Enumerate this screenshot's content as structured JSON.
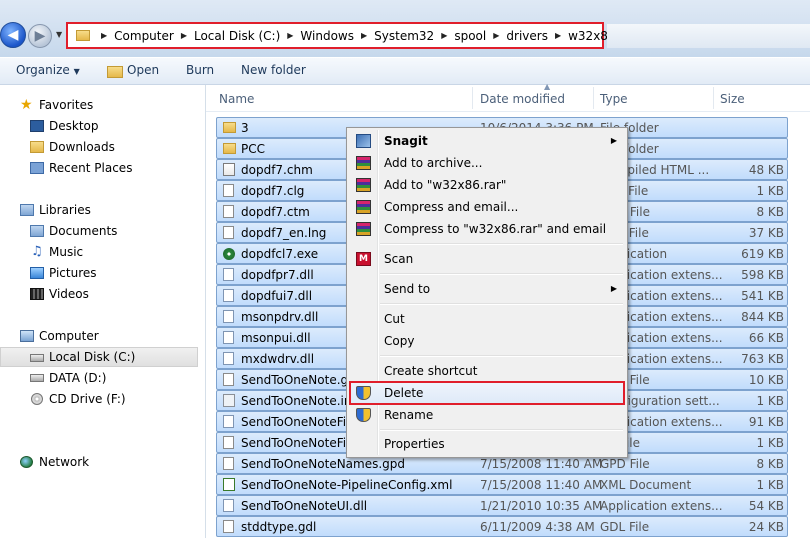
{
  "address": {
    "crumbs": [
      "Computer",
      "Local Disk (C:)",
      "Windows",
      "System32",
      "spool",
      "drivers",
      "w32x86"
    ]
  },
  "toolbar": {
    "organize": "Organize",
    "open": "Open",
    "burn": "Burn",
    "new_folder": "New folder"
  },
  "nav": {
    "favorites": "Favorites",
    "desktop": "Desktop",
    "downloads": "Downloads",
    "recent_places": "Recent Places",
    "libraries": "Libraries",
    "documents": "Documents",
    "music": "Music",
    "pictures": "Pictures",
    "videos": "Videos",
    "computer": "Computer",
    "local_disk": "Local Disk (C:)",
    "data_drive": "DATA (D:)",
    "cd_drive": "CD Drive (F:)",
    "network": "Network"
  },
  "columns": {
    "name": "Name",
    "date": "Date modified",
    "type": "Type",
    "size": "Size"
  },
  "files": [
    {
      "name": "3",
      "date": "10/6/2014 3:36 PM",
      "type": "File folder",
      "size": ""
    },
    {
      "name": "PCC",
      "date": "",
      "type": "File folder",
      "size": ""
    },
    {
      "name": "dopdf7.chm",
      "date": "",
      "type": "Compiled HTML ...",
      "size": "48 KB"
    },
    {
      "name": "dopdf7.clg",
      "date": "",
      "type": "CLG File",
      "size": "1 KB"
    },
    {
      "name": "dopdf7.ctm",
      "date": "",
      "type": "CTM File",
      "size": "8 KB"
    },
    {
      "name": "dopdf7_en.lng",
      "date": "",
      "type": "LNG File",
      "size": "37 KB"
    },
    {
      "name": "dopdfcl7.exe",
      "date": "",
      "type": "Application",
      "size": "619 KB"
    },
    {
      "name": "dopdfpr7.dll",
      "date": "",
      "type": "Application extens...",
      "size": "598 KB"
    },
    {
      "name": "dopdfui7.dll",
      "date": "",
      "type": "Application extens...",
      "size": "541 KB"
    },
    {
      "name": "msonpdrv.dll",
      "date": "",
      "type": "Application extens...",
      "size": "844 KB"
    },
    {
      "name": "msonpui.dll",
      "date": "",
      "type": "Application extens...",
      "size": "66 KB"
    },
    {
      "name": "mxdwdrv.dll",
      "date": "",
      "type": "Application extens...",
      "size": "763 KB"
    },
    {
      "name": "SendToOneNote.gpd",
      "date": "",
      "type": "GPD File",
      "size": "10 KB"
    },
    {
      "name": "SendToOneNote.ini",
      "date": "",
      "type": "Configuration sett...",
      "size": "1 KB"
    },
    {
      "name": "SendToOneNoteFilter.dll",
      "date": "",
      "type": "Application extens...",
      "size": "91 KB"
    },
    {
      "name": "SendToOneNoteFilter.ini",
      "date": "",
      "type": "INI File",
      "size": "1 KB"
    },
    {
      "name": "SendToOneNoteNames.gpd",
      "date": "7/15/2008 11:40 AM",
      "type": "GPD File",
      "size": "8 KB"
    },
    {
      "name": "SendToOneNote-PipelineConfig.xml",
      "date": "7/15/2008 11:40 AM",
      "type": "XML Document",
      "size": "1 KB"
    },
    {
      "name": "SendToOneNoteUI.dll",
      "date": "1/21/2010 10:35 AM",
      "type": "Application extens...",
      "size": "54 KB"
    },
    {
      "name": "stddtype.gdl",
      "date": "6/11/2009 4:38 AM",
      "type": "GDL File",
      "size": "24 KB"
    }
  ],
  "context_menu": {
    "snagit": "Snagit",
    "add_to_archive": "Add to archive...",
    "add_to_rar": "Add to \"w32x86.rar\"",
    "compress_email": "Compress and email...",
    "compress_rar_email": "Compress to \"w32x86.rar\" and email",
    "scan": "Scan",
    "send_to": "Send to",
    "cut": "Cut",
    "copy": "Copy",
    "create_shortcut": "Create shortcut",
    "delete": "Delete",
    "rename": "Rename",
    "properties": "Properties"
  },
  "colors": {
    "highlight_outline": "#e01e2b",
    "selection_fill": "#cde4fc",
    "selection_border": "#7da2ce"
  }
}
